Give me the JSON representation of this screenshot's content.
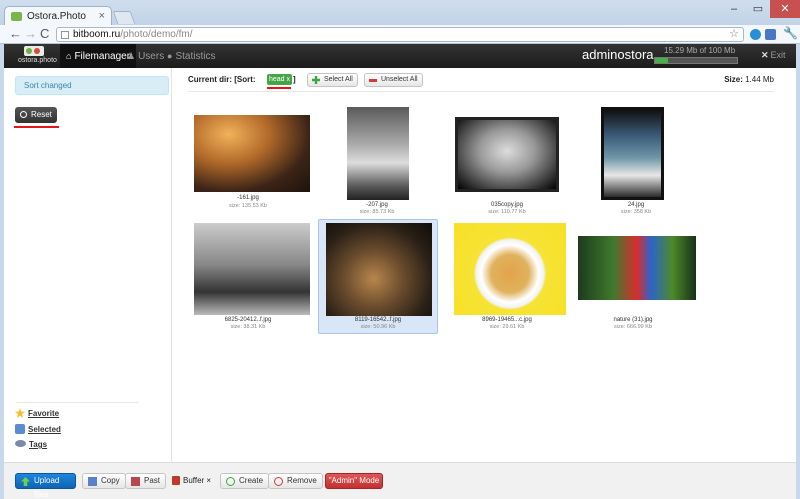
{
  "browser": {
    "tab_title": "Ostora.Photo",
    "tab_close": "×",
    "url_domain": "bitboom.ru",
    "url_path": "/photo/demo/fm/",
    "win_min": "–",
    "win_max": "▭",
    "win_close": "✕",
    "back": "←",
    "forward": "→",
    "reload": "C",
    "star": "☆",
    "wrench": "🔧"
  },
  "navbar": {
    "brand_text": "ostora.photo",
    "items": [
      {
        "label": "Filemanager",
        "icon": "home-icon",
        "glyph": "⌂"
      },
      {
        "label": "Users",
        "icon": "user-icon",
        "glyph": "♟"
      },
      {
        "label": "Statistics",
        "icon": "info-icon",
        "glyph": "●"
      }
    ],
    "username": "adminostora",
    "quota_text": "15.29 Mb of 100 Mb",
    "quota_fraction": 0.153,
    "exit_glyph": "✕",
    "exit_label": "Exit"
  },
  "sidebar": {
    "alert": "Sort changed",
    "reset_label": "Reset",
    "links": [
      {
        "label": "Favorite",
        "icon": "star-icon"
      },
      {
        "label": "Selected",
        "icon": "users-icon"
      },
      {
        "label": "Tags",
        "icon": "tags-icon"
      }
    ]
  },
  "toolbar": {
    "current_dir_label": "Current dir: [Sort:",
    "sort_badge": "head x",
    "sort_close": "]",
    "select_all": "Select All",
    "unselect_all": "Unselect All",
    "size_label": "Size:",
    "size_value": "1.44 Mb"
  },
  "files": [
    {
      "name": "-161.jpg",
      "size": "size: 135.53 Kb",
      "image": "wedding",
      "selected": false
    },
    {
      "name": "-207.jpg",
      "size": "size: 85.73 Kb",
      "image": "dancer",
      "selected": false
    },
    {
      "name": "035copy.jpg",
      "size": "size: 110.77 Kb",
      "image": "bw-girl",
      "selected": false
    },
    {
      "name": "24.jpg",
      "size": "size: 358 Kb",
      "image": "lake",
      "selected": false
    },
    {
      "name": "6825-20412..f.jpg",
      "size": "size: 38.31 Kb",
      "image": "golf",
      "selected": false
    },
    {
      "name": "8119-16542..f.jpg",
      "size": "size: 50.96 Kb",
      "image": "tarsier",
      "selected": true
    },
    {
      "name": "8969-19465...c.jpg",
      "size": "size: 29.61 Kb",
      "image": "soup",
      "selected": false
    },
    {
      "name": "nature (31).jpg",
      "size": "size: 666.99 Kb",
      "image": "parrot",
      "selected": false
    }
  ],
  "bottombar": {
    "upload": "Upload files",
    "copy": "Copy",
    "past": "Past",
    "buffer": "Buffer ×",
    "create": "Create",
    "remove": "Remove",
    "admin_mode": "\"Admin\" Mode"
  }
}
